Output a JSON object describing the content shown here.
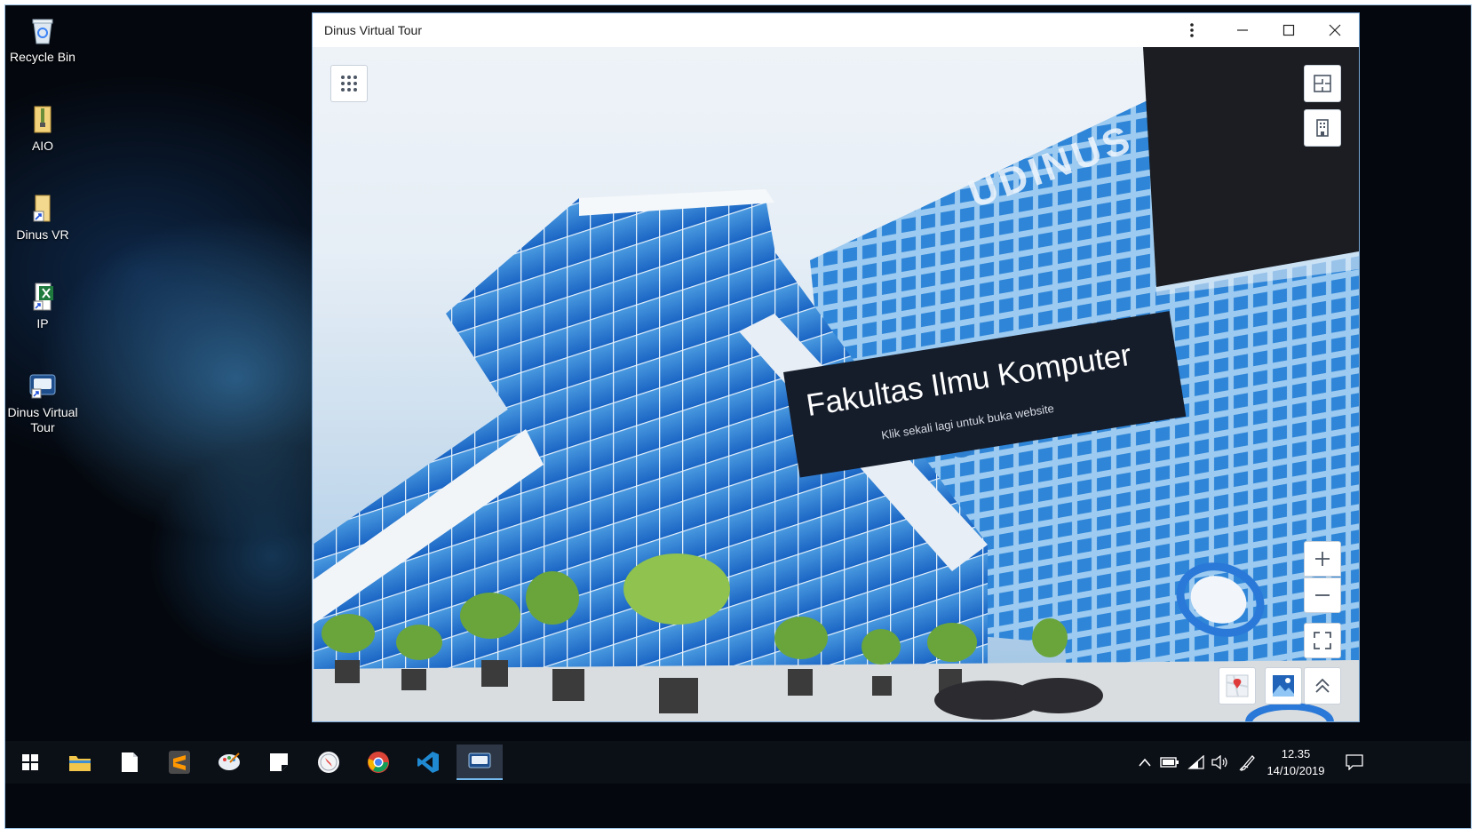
{
  "desktop": {
    "icons": [
      {
        "label": "Recycle Bin"
      },
      {
        "label": "AIO"
      },
      {
        "label": "Dinus VR"
      },
      {
        "label": "IP"
      },
      {
        "label": "Dinus Virtual Tour"
      }
    ]
  },
  "window": {
    "title": "Dinus Virtual Tour",
    "hotspot": {
      "title": "Fakultas Ilmu Komputer",
      "subtitle": "Klik sekali lagi untuk buka website"
    },
    "building_sign": "UDINUS"
  },
  "taskbar": {
    "time": "12.35",
    "date": "14/10/2019"
  }
}
